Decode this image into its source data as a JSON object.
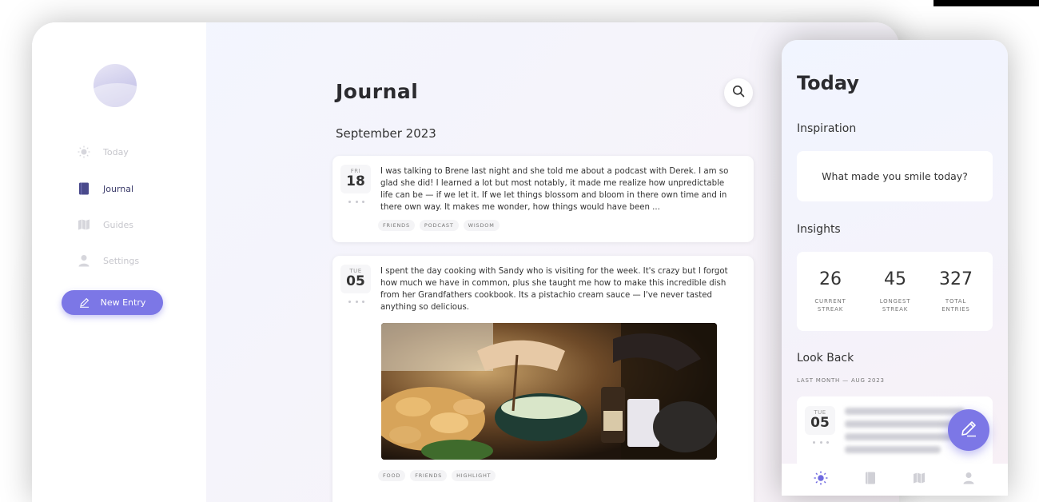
{
  "sidebar": {
    "items": [
      {
        "label": "Today",
        "icon": "sun-icon",
        "active": false
      },
      {
        "label": "Journal",
        "icon": "book-icon",
        "active": true
      },
      {
        "label": "Guides",
        "icon": "map-icon",
        "active": false
      },
      {
        "label": "Settings",
        "icon": "user-icon",
        "active": false
      }
    ],
    "new_entry_label": "New Entry"
  },
  "main": {
    "title": "Journal",
    "month": "September 2023",
    "entries": [
      {
        "dow": "FRI",
        "day": "18",
        "text": "I was talking to Brene last night and she told me about a podcast with Derek. I am so glad she did! I learned a lot but most notably, it made me realize how unpredictable life can be — if we let it. If we let things blossom and bloom in there own time and in there own way. It makes me wonder, how things would have been ...",
        "tags": [
          "FRIENDS",
          "PODCAST",
          "WISDOM"
        ]
      },
      {
        "dow": "TUE",
        "day": "05",
        "text": "I spent the day cooking with Sandy who is visiting for the week. It's crazy but I forgot how much we have in common, plus she taught me how to make this incredible dish from her Grandfathers cookbook. Its a pistachio cream sauce — I've never tasted anything so delicious.",
        "tags": [
          "FOOD",
          "FRIENDS",
          "HIGHLIGHT"
        ]
      }
    ]
  },
  "today": {
    "title": "Today",
    "inspiration_label": "Inspiration",
    "inspiration_prompt": "What made you smile today?",
    "insights_label": "Insights",
    "stats": [
      {
        "value": "26",
        "label_1": "CURRENT",
        "label_2": "STREAK"
      },
      {
        "value": "45",
        "label_1": "LONGEST",
        "label_2": "STREAK"
      },
      {
        "value": "327",
        "label_1": "TOTAL",
        "label_2": "ENTRIES"
      }
    ],
    "lookback_label": "Look Back",
    "lookback_sub": "LAST MONTH — AUG 2023",
    "lookback_entry": {
      "dow": "TUE",
      "day": "05"
    }
  },
  "colors": {
    "accent": "#7c77e6",
    "active_nav": "#3b3b6a"
  }
}
